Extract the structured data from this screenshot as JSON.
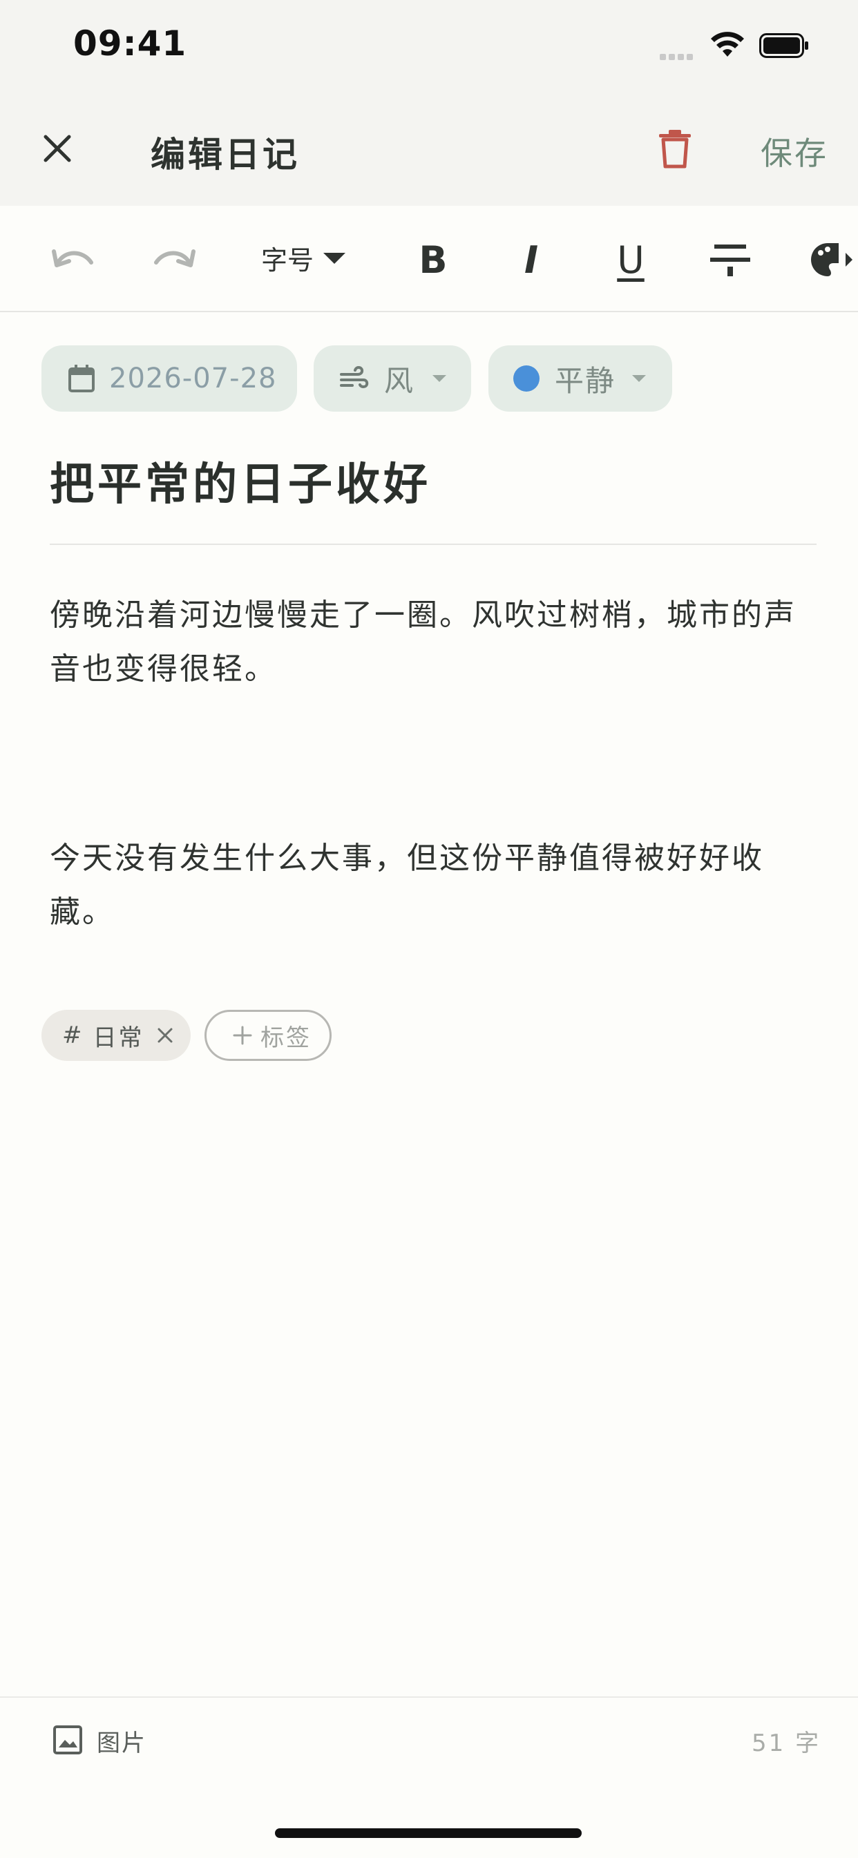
{
  "status_bar": {
    "time": "09:41"
  },
  "nav": {
    "title": "编辑日记",
    "save_label": "保存"
  },
  "toolbar": {
    "font_size_label": "字号",
    "bold": "B",
    "italic": "I",
    "underline": "U"
  },
  "meta": {
    "date": "2026-07-28",
    "weather": "风",
    "mood": "平静",
    "mood_color": "#4a90d9"
  },
  "entry": {
    "title": "把平常的日子收好",
    "paragraphs": [
      "傍晚沿着河边慢慢走了一圈。风吹过树梢，城市的声音也变得很轻。",
      "今天没有发生什么大事，但这份平静值得被好好收藏。"
    ]
  },
  "tags": {
    "items": [
      {
        "hash": "#",
        "label": "日常"
      }
    ],
    "add_label": "标签"
  },
  "footer": {
    "image_label": "图片",
    "word_count": "51 字"
  },
  "colors": {
    "accent": "#6e8a7a",
    "danger": "#c0564b",
    "chip_bg": "#e4ece6"
  }
}
